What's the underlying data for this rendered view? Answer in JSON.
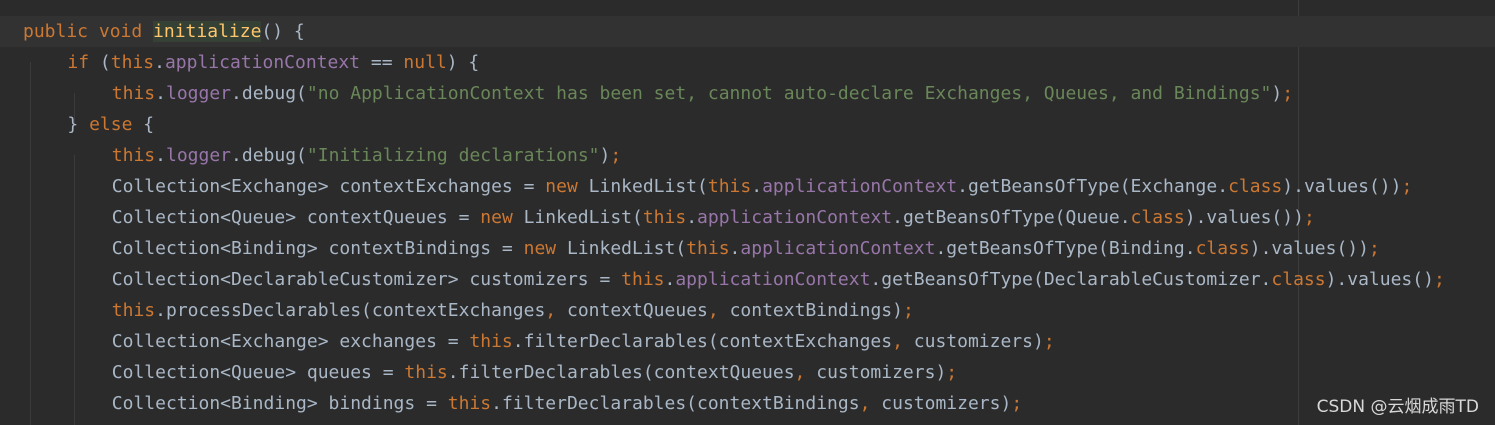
{
  "colors": {
    "background": "#2b2b2b",
    "keyword": "#cc7832",
    "method_declaration": "#ffc66d",
    "field": "#9876aa",
    "string": "#6a8759",
    "plain_text": "#a9b7c6"
  },
  "watermark": "CSDN @云烟成雨TD",
  "code_lines": [
    {
      "tokens": [
        {
          "t": "public void ",
          "c": "kw"
        },
        {
          "t": "initialize",
          "c": "fn hl"
        },
        {
          "t": "() {",
          "c": "txt"
        }
      ]
    },
    {
      "tokens": [
        {
          "t": "if ",
          "c": "kw"
        },
        {
          "t": "(",
          "c": "txt"
        },
        {
          "t": "this",
          "c": "kw"
        },
        {
          "t": ".",
          "c": "txt"
        },
        {
          "t": "applicationContext",
          "c": "field"
        },
        {
          "t": " == ",
          "c": "txt"
        },
        {
          "t": "null",
          "c": "kw"
        },
        {
          "t": ") {",
          "c": "txt"
        }
      ]
    },
    {
      "tokens": [
        {
          "t": "this",
          "c": "kw"
        },
        {
          "t": ".",
          "c": "txt"
        },
        {
          "t": "logger",
          "c": "field"
        },
        {
          "t": ".debug(",
          "c": "txt"
        },
        {
          "t": "\"no ApplicationContext has been set, cannot auto-declare Exchanges, Queues, and Bindings\"",
          "c": "str"
        },
        {
          "t": ")",
          "c": "txt"
        },
        {
          "t": ";",
          "c": "punc"
        }
      ]
    },
    {
      "tokens": [
        {
          "t": "} ",
          "c": "txt"
        },
        {
          "t": "else",
          "c": "kw"
        },
        {
          "t": " {",
          "c": "txt"
        }
      ]
    },
    {
      "tokens": [
        {
          "t": "this",
          "c": "kw"
        },
        {
          "t": ".",
          "c": "txt"
        },
        {
          "t": "logger",
          "c": "field"
        },
        {
          "t": ".debug(",
          "c": "txt"
        },
        {
          "t": "\"Initializing declarations\"",
          "c": "str"
        },
        {
          "t": ")",
          "c": "txt"
        },
        {
          "t": ";",
          "c": "punc"
        }
      ]
    },
    {
      "tokens": [
        {
          "t": "Collection<Exchange> contextExchanges = ",
          "c": "txt"
        },
        {
          "t": "new ",
          "c": "kw"
        },
        {
          "t": "LinkedList(",
          "c": "txt"
        },
        {
          "t": "this",
          "c": "kw"
        },
        {
          "t": ".",
          "c": "txt"
        },
        {
          "t": "applicationContext",
          "c": "field"
        },
        {
          "t": ".getBeansOfType(Exchange.",
          "c": "txt"
        },
        {
          "t": "class",
          "c": "kw"
        },
        {
          "t": ").values())",
          "c": "txt"
        },
        {
          "t": ";",
          "c": "punc"
        }
      ]
    },
    {
      "tokens": [
        {
          "t": "Collection<Queue> contextQueues = ",
          "c": "txt"
        },
        {
          "t": "new ",
          "c": "kw"
        },
        {
          "t": "LinkedList(",
          "c": "txt"
        },
        {
          "t": "this",
          "c": "kw"
        },
        {
          "t": ".",
          "c": "txt"
        },
        {
          "t": "applicationContext",
          "c": "field"
        },
        {
          "t": ".getBeansOfType(Queue.",
          "c": "txt"
        },
        {
          "t": "class",
          "c": "kw"
        },
        {
          "t": ").values())",
          "c": "txt"
        },
        {
          "t": ";",
          "c": "punc"
        }
      ]
    },
    {
      "tokens": [
        {
          "t": "Collection<Binding> contextBindings = ",
          "c": "txt"
        },
        {
          "t": "new ",
          "c": "kw"
        },
        {
          "t": "LinkedList(",
          "c": "txt"
        },
        {
          "t": "this",
          "c": "kw"
        },
        {
          "t": ".",
          "c": "txt"
        },
        {
          "t": "applicationContext",
          "c": "field"
        },
        {
          "t": ".getBeansOfType(Binding.",
          "c": "txt"
        },
        {
          "t": "class",
          "c": "kw"
        },
        {
          "t": ").values())",
          "c": "txt"
        },
        {
          "t": ";",
          "c": "punc"
        }
      ]
    },
    {
      "tokens": [
        {
          "t": "Collection<DeclarableCustomizer> customizers = ",
          "c": "txt"
        },
        {
          "t": "this",
          "c": "kw"
        },
        {
          "t": ".",
          "c": "txt"
        },
        {
          "t": "applicationContext",
          "c": "field"
        },
        {
          "t": ".getBeansOfType(DeclarableCustomizer.",
          "c": "txt"
        },
        {
          "t": "class",
          "c": "kw"
        },
        {
          "t": ").values()",
          "c": "txt"
        },
        {
          "t": ";",
          "c": "punc"
        }
      ]
    },
    {
      "tokens": [
        {
          "t": "this",
          "c": "kw"
        },
        {
          "t": ".processDeclarables(contextExchanges",
          "c": "txt"
        },
        {
          "t": ", ",
          "c": "punc"
        },
        {
          "t": "contextQueues",
          "c": "txt"
        },
        {
          "t": ", ",
          "c": "punc"
        },
        {
          "t": "contextBindings)",
          "c": "txt"
        },
        {
          "t": ";",
          "c": "punc"
        }
      ]
    },
    {
      "tokens": [
        {
          "t": "Collection<Exchange> exchanges = ",
          "c": "txt"
        },
        {
          "t": "this",
          "c": "kw"
        },
        {
          "t": ".filterDeclarables(contextExchanges",
          "c": "txt"
        },
        {
          "t": ", ",
          "c": "punc"
        },
        {
          "t": "customizers)",
          "c": "txt"
        },
        {
          "t": ";",
          "c": "punc"
        }
      ]
    },
    {
      "tokens": [
        {
          "t": "Collection<Queue> queues = ",
          "c": "txt"
        },
        {
          "t": "this",
          "c": "kw"
        },
        {
          "t": ".filterDeclarables(contextQueues",
          "c": "txt"
        },
        {
          "t": ", ",
          "c": "punc"
        },
        {
          "t": "customizers)",
          "c": "txt"
        },
        {
          "t": ";",
          "c": "punc"
        }
      ]
    },
    {
      "tokens": [
        {
          "t": "Collection<Binding> bindings = ",
          "c": "txt"
        },
        {
          "t": "this",
          "c": "kw"
        },
        {
          "t": ".filterDeclarables(contextBindings",
          "c": "txt"
        },
        {
          "t": ", ",
          "c": "punc"
        },
        {
          "t": "customizers)",
          "c": "txt"
        },
        {
          "t": ";",
          "c": "punc"
        }
      ]
    }
  ]
}
